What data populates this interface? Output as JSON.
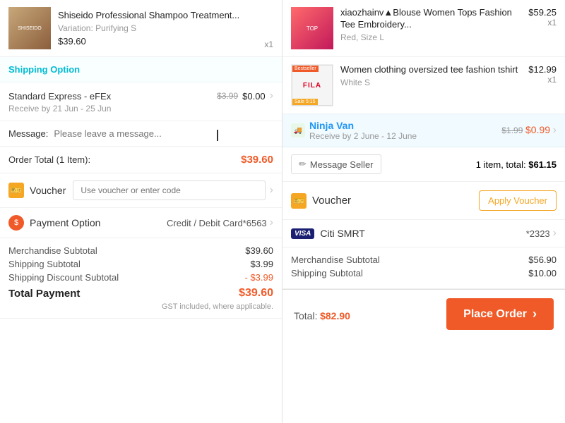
{
  "left": {
    "product": {
      "name": "Shiseido Professional Shampoo Treatment...",
      "variation": "Variation: Purifying S",
      "price": "$39.60",
      "qty": "x1"
    },
    "shipping_section_label": "Shipping Option",
    "shipping": {
      "name": "Standard Express - eFEx",
      "date": "Receive by 21 Jun - 25 Jun",
      "original_price": "$3.99",
      "final_price": "$0.00"
    },
    "message_label": "Message:",
    "message_placeholder": "Please leave a message...",
    "order_total_label": "Order Total (1 Item):",
    "order_total_value": "$39.60",
    "voucher_label": "Voucher",
    "voucher_placeholder": "Use voucher or enter code",
    "payment_label": "Payment Option",
    "payment_value": "Credit / Debit Card*6563",
    "summary": {
      "merchandise_label": "Merchandise Subtotal",
      "merchandise_value": "$39.60",
      "shipping_label": "Shipping Subtotal",
      "shipping_value": "$3.99",
      "shipping_discount_label": "Shipping Discount Subtotal",
      "shipping_discount_value": "- $3.99",
      "total_label": "Total Payment",
      "total_value": "$39.60",
      "gst_note": "GST included, where applicable."
    }
  },
  "right": {
    "products": [
      {
        "name": "xiaozhainv▲Blouse Women Tops Fashion Tee Embroidery...",
        "variant": "Red, Size L",
        "price": "$59.25",
        "qty": "x1",
        "thumb_type": "blouse"
      },
      {
        "name": "Women clothing oversized tee fashion tshirt",
        "variant": "White S",
        "price": "$12.99",
        "qty": "x1",
        "thumb_type": "fila"
      }
    ],
    "ninja_van": {
      "name": "Ninja Van",
      "date": "Receive by 2 June - 12 June",
      "original_price": "$1.99",
      "final_price": "$0.99"
    },
    "message_seller_label": "Message Seller",
    "item_total_label": "1 item, total:",
    "item_total_value": "$61.15",
    "voucher_label": "Voucher",
    "apply_voucher_label": "Apply Voucher",
    "payment": {
      "badge": "VISA",
      "name": "Citi SMRT",
      "number": "*2323"
    },
    "summary": {
      "merchandise_label": "Merchandise Subtotal",
      "merchandise_value": "$56.90",
      "shipping_label": "Shipping Subtotal",
      "shipping_value": "$10.00"
    },
    "footer": {
      "total_label": "Total:",
      "total_symbol": "$",
      "total_amount": "82.90",
      "place_order_label": "Place Order"
    }
  }
}
